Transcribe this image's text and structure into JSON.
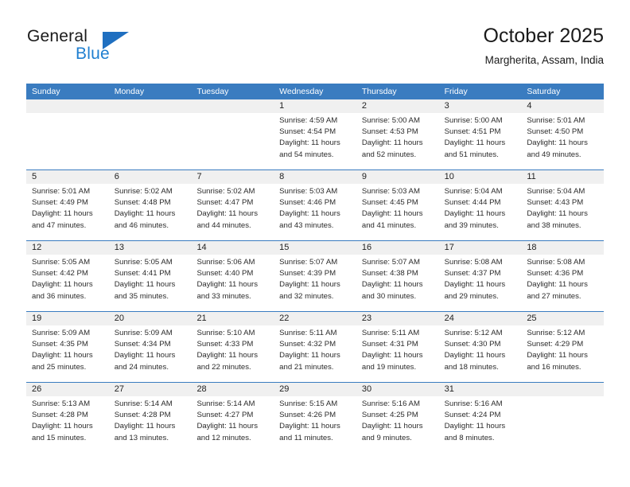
{
  "brand": {
    "name_top": "General",
    "name_bottom": "Blue",
    "accent_color": "#1f7fd0",
    "triangle_color": "#1f6fc0"
  },
  "header": {
    "title": "October 2025",
    "subtitle": "Margherita, Assam, India"
  },
  "calendar": {
    "header_bg": "#3a7cc0",
    "header_text_color": "#ffffff",
    "date_bar_bg": "#f0f0f0",
    "weekday_headers": [
      "Sunday",
      "Monday",
      "Tuesday",
      "Wednesday",
      "Thursday",
      "Friday",
      "Saturday"
    ],
    "weeks": [
      [
        {
          "day": "",
          "empty": true
        },
        {
          "day": "",
          "empty": true
        },
        {
          "day": "",
          "empty": true
        },
        {
          "day": "1",
          "sunrise": "Sunrise: 4:59 AM",
          "sunset": "Sunset: 4:54 PM",
          "daylight1": "Daylight: 11 hours",
          "daylight2": "and 54 minutes."
        },
        {
          "day": "2",
          "sunrise": "Sunrise: 5:00 AM",
          "sunset": "Sunset: 4:53 PM",
          "daylight1": "Daylight: 11 hours",
          "daylight2": "and 52 minutes."
        },
        {
          "day": "3",
          "sunrise": "Sunrise: 5:00 AM",
          "sunset": "Sunset: 4:51 PM",
          "daylight1": "Daylight: 11 hours",
          "daylight2": "and 51 minutes."
        },
        {
          "day": "4",
          "sunrise": "Sunrise: 5:01 AM",
          "sunset": "Sunset: 4:50 PM",
          "daylight1": "Daylight: 11 hours",
          "daylight2": "and 49 minutes."
        }
      ],
      [
        {
          "day": "5",
          "sunrise": "Sunrise: 5:01 AM",
          "sunset": "Sunset: 4:49 PM",
          "daylight1": "Daylight: 11 hours",
          "daylight2": "and 47 minutes."
        },
        {
          "day": "6",
          "sunrise": "Sunrise: 5:02 AM",
          "sunset": "Sunset: 4:48 PM",
          "daylight1": "Daylight: 11 hours",
          "daylight2": "and 46 minutes."
        },
        {
          "day": "7",
          "sunrise": "Sunrise: 5:02 AM",
          "sunset": "Sunset: 4:47 PM",
          "daylight1": "Daylight: 11 hours",
          "daylight2": "and 44 minutes."
        },
        {
          "day": "8",
          "sunrise": "Sunrise: 5:03 AM",
          "sunset": "Sunset: 4:46 PM",
          "daylight1": "Daylight: 11 hours",
          "daylight2": "and 43 minutes."
        },
        {
          "day": "9",
          "sunrise": "Sunrise: 5:03 AM",
          "sunset": "Sunset: 4:45 PM",
          "daylight1": "Daylight: 11 hours",
          "daylight2": "and 41 minutes."
        },
        {
          "day": "10",
          "sunrise": "Sunrise: 5:04 AM",
          "sunset": "Sunset: 4:44 PM",
          "daylight1": "Daylight: 11 hours",
          "daylight2": "and 39 minutes."
        },
        {
          "day": "11",
          "sunrise": "Sunrise: 5:04 AM",
          "sunset": "Sunset: 4:43 PM",
          "daylight1": "Daylight: 11 hours",
          "daylight2": "and 38 minutes."
        }
      ],
      [
        {
          "day": "12",
          "sunrise": "Sunrise: 5:05 AM",
          "sunset": "Sunset: 4:42 PM",
          "daylight1": "Daylight: 11 hours",
          "daylight2": "and 36 minutes."
        },
        {
          "day": "13",
          "sunrise": "Sunrise: 5:05 AM",
          "sunset": "Sunset: 4:41 PM",
          "daylight1": "Daylight: 11 hours",
          "daylight2": "and 35 minutes."
        },
        {
          "day": "14",
          "sunrise": "Sunrise: 5:06 AM",
          "sunset": "Sunset: 4:40 PM",
          "daylight1": "Daylight: 11 hours",
          "daylight2": "and 33 minutes."
        },
        {
          "day": "15",
          "sunrise": "Sunrise: 5:07 AM",
          "sunset": "Sunset: 4:39 PM",
          "daylight1": "Daylight: 11 hours",
          "daylight2": "and 32 minutes."
        },
        {
          "day": "16",
          "sunrise": "Sunrise: 5:07 AM",
          "sunset": "Sunset: 4:38 PM",
          "daylight1": "Daylight: 11 hours",
          "daylight2": "and 30 minutes."
        },
        {
          "day": "17",
          "sunrise": "Sunrise: 5:08 AM",
          "sunset": "Sunset: 4:37 PM",
          "daylight1": "Daylight: 11 hours",
          "daylight2": "and 29 minutes."
        },
        {
          "day": "18",
          "sunrise": "Sunrise: 5:08 AM",
          "sunset": "Sunset: 4:36 PM",
          "daylight1": "Daylight: 11 hours",
          "daylight2": "and 27 minutes."
        }
      ],
      [
        {
          "day": "19",
          "sunrise": "Sunrise: 5:09 AM",
          "sunset": "Sunset: 4:35 PM",
          "daylight1": "Daylight: 11 hours",
          "daylight2": "and 25 minutes."
        },
        {
          "day": "20",
          "sunrise": "Sunrise: 5:09 AM",
          "sunset": "Sunset: 4:34 PM",
          "daylight1": "Daylight: 11 hours",
          "daylight2": "and 24 minutes."
        },
        {
          "day": "21",
          "sunrise": "Sunrise: 5:10 AM",
          "sunset": "Sunset: 4:33 PM",
          "daylight1": "Daylight: 11 hours",
          "daylight2": "and 22 minutes."
        },
        {
          "day": "22",
          "sunrise": "Sunrise: 5:11 AM",
          "sunset": "Sunset: 4:32 PM",
          "daylight1": "Daylight: 11 hours",
          "daylight2": "and 21 minutes."
        },
        {
          "day": "23",
          "sunrise": "Sunrise: 5:11 AM",
          "sunset": "Sunset: 4:31 PM",
          "daylight1": "Daylight: 11 hours",
          "daylight2": "and 19 minutes."
        },
        {
          "day": "24",
          "sunrise": "Sunrise: 5:12 AM",
          "sunset": "Sunset: 4:30 PM",
          "daylight1": "Daylight: 11 hours",
          "daylight2": "and 18 minutes."
        },
        {
          "day": "25",
          "sunrise": "Sunrise: 5:12 AM",
          "sunset": "Sunset: 4:29 PM",
          "daylight1": "Daylight: 11 hours",
          "daylight2": "and 16 minutes."
        }
      ],
      [
        {
          "day": "26",
          "sunrise": "Sunrise: 5:13 AM",
          "sunset": "Sunset: 4:28 PM",
          "daylight1": "Daylight: 11 hours",
          "daylight2": "and 15 minutes."
        },
        {
          "day": "27",
          "sunrise": "Sunrise: 5:14 AM",
          "sunset": "Sunset: 4:28 PM",
          "daylight1": "Daylight: 11 hours",
          "daylight2": "and 13 minutes."
        },
        {
          "day": "28",
          "sunrise": "Sunrise: 5:14 AM",
          "sunset": "Sunset: 4:27 PM",
          "daylight1": "Daylight: 11 hours",
          "daylight2": "and 12 minutes."
        },
        {
          "day": "29",
          "sunrise": "Sunrise: 5:15 AM",
          "sunset": "Sunset: 4:26 PM",
          "daylight1": "Daylight: 11 hours",
          "daylight2": "and 11 minutes."
        },
        {
          "day": "30",
          "sunrise": "Sunrise: 5:16 AM",
          "sunset": "Sunset: 4:25 PM",
          "daylight1": "Daylight: 11 hours",
          "daylight2": "and 9 minutes."
        },
        {
          "day": "31",
          "sunrise": "Sunrise: 5:16 AM",
          "sunset": "Sunset: 4:24 PM",
          "daylight1": "Daylight: 11 hours",
          "daylight2": "and 8 minutes."
        },
        {
          "day": "",
          "empty": true
        }
      ]
    ]
  }
}
